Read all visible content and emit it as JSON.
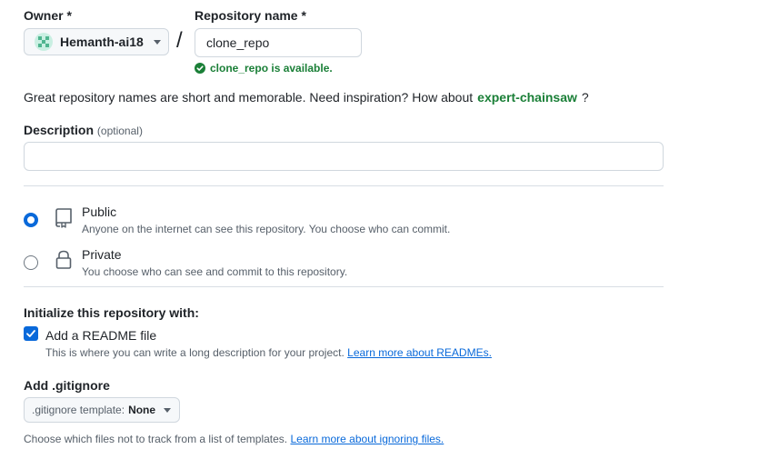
{
  "owner": {
    "label": "Owner *",
    "name": "Hemanth-ai18"
  },
  "repo": {
    "label": "Repository name *",
    "value": "clone_repo",
    "availability": "clone_repo is available."
  },
  "slash": "/",
  "hint": {
    "text": "Great repository names are short and memorable. Need inspiration? How about",
    "suggestion": "expert-chainsaw",
    "end": "?"
  },
  "description": {
    "label": "Description",
    "optional": "(optional)",
    "value": ""
  },
  "visibility": {
    "public": {
      "title": "Public",
      "desc": "Anyone on the internet can see this repository. You choose who can commit.",
      "selected": true
    },
    "private": {
      "title": "Private",
      "desc": "You choose who can see and commit to this repository.",
      "selected": false
    }
  },
  "init": {
    "heading": "Initialize this repository with:",
    "readme_label": "Add a README file",
    "readme_desc": "This is where you can write a long description for your project.",
    "readme_link": "Learn more about READMEs.",
    "readme_checked": true
  },
  "gitignore": {
    "heading": "Add .gitignore",
    "select_prefix": ".gitignore template:",
    "select_value": "None",
    "desc": "Choose which files not to track from a list of templates.",
    "link": "Learn more about ignoring files."
  },
  "colors": {
    "accent": "#0969da",
    "success": "#1a7f37",
    "muted": "#57606a"
  },
  "icons": {
    "public": "repo-icon",
    "private": "lock-icon",
    "check": "check-circle-icon",
    "caret": "triangle-down-icon"
  }
}
